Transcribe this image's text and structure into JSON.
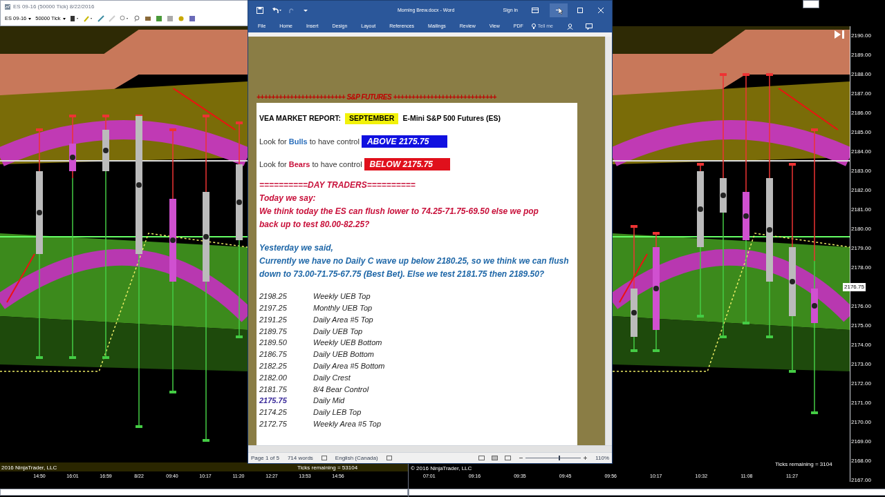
{
  "left_chart": {
    "title": "ES 09-16 (50000 Tick) 8/22/2016",
    "instrument": "ES 09-16",
    "interval": "50000 Tick",
    "time_labels": [
      "14:50",
      "16:01",
      "16:59",
      "8/22",
      "09:40",
      "10:17",
      "11:20",
      "12:27",
      "13:53",
      "14:56"
    ],
    "copyright": "2016 NinjaTrader, LLC",
    "ticks_remaining": "Ticks remaining = 53104"
  },
  "right_chart": {
    "labels_above": [
      "2190.00",
      "2189.00",
      "2188.00",
      "2187.00",
      "2186.00",
      "2185.00",
      "2184.00",
      "2183.00",
      "2182.00",
      "2181.00",
      "2180.00",
      "2179.00",
      "2178.00"
    ],
    "current_price": "2176.75",
    "labels_below": [
      "2176.00",
      "2175.00",
      "2174.00",
      "2173.00",
      "2172.00",
      "2171.00",
      "2170.00",
      "2169.00",
      "2168.00",
      "2167.00"
    ],
    "time_labels": [
      "07:01",
      "09:16",
      "09:35",
      "09:45",
      "09:56",
      "10:17",
      "10:32",
      "11:08",
      "11:27"
    ],
    "copyright": "© 2016 NinjaTrader, LLC",
    "ticks_remaining": "Ticks remaining = 3104"
  },
  "word": {
    "title": "Morning Brew.docx - Word",
    "sign_in": "Sign in",
    "tabs": [
      "File",
      "Home",
      "Insert",
      "Design",
      "Layout",
      "References",
      "Mailings",
      "Review",
      "View",
      "PDF"
    ],
    "tell_me": "Tell me",
    "document": {
      "banner": "++++++++++++++++++++++++ S&P FUTURES ++++++++++++++++++++++++++++",
      "report_label": "VEA MARKET REPORT:",
      "month": "SEPTEMBER",
      "product": "E-Mini S&P 500 Futures (ES)",
      "controls": [
        {
          "prefix": "Look for ",
          "keyword": "Bulls",
          "suffix": " to have control",
          "level": "ABOVE 2175.75",
          "color": "#1010e0"
        },
        {
          "prefix": "Look for ",
          "keyword": "Bears",
          "suffix": " to have control",
          "level": "BELOW 2175.75",
          "color": "#e0101c"
        }
      ],
      "section_heading": "==========DAY TRADERS==========",
      "today_heading": "Today we say:",
      "today_text": "We think today the ES can flush lower to 74.25-71.75-69.50 else we pop back up to test 80.00-82.25?",
      "yesterday_heading": "Yesterday we said,",
      "yesterday_text": "Currently we have no Daily C wave up below 2180.25, so we think we can flush down to 73.00-71.75-67.75 (Best Bet). Else we test 2181.75 then 2189.50?",
      "levels": [
        {
          "price": "2198.25",
          "label": "Weekly UEB Top",
          "highlighted": false
        },
        {
          "price": "2197.25",
          "label": "Monthly UEB Top",
          "highlighted": false
        },
        {
          "price": "2191.25",
          "label": "Daily Area #5 Top",
          "highlighted": false
        },
        {
          "price": "2189.75",
          "label": "Daily UEB Top",
          "highlighted": false
        },
        {
          "price": "2189.50",
          "label": "Weekly UEB Bottom",
          "highlighted": false
        },
        {
          "price": "2186.75",
          "label": "Daily UEB Bottom",
          "highlighted": false
        },
        {
          "price": "2182.25",
          "label": "Daily Area #5 Bottom",
          "highlighted": false
        },
        {
          "price": "2182.00",
          "label": "Daily Crest",
          "highlighted": false
        },
        {
          "price": "2181.75",
          "label": "8/4 Bear Control",
          "highlighted": false
        },
        {
          "price": "2175.75",
          "label": "Daily Mid",
          "highlighted": true
        },
        {
          "price": "2174.25",
          "label": "Daily LEB Top",
          "highlighted": false
        },
        {
          "price": "2172.75",
          "label": "Weekly Area #5 Top",
          "highlighted": false
        }
      ]
    },
    "status_bar": {
      "page": "Page 1 of 5",
      "words": "714 words",
      "language": "English (Canada)",
      "zoom": "110%",
      "level": 0.6
    }
  }
}
